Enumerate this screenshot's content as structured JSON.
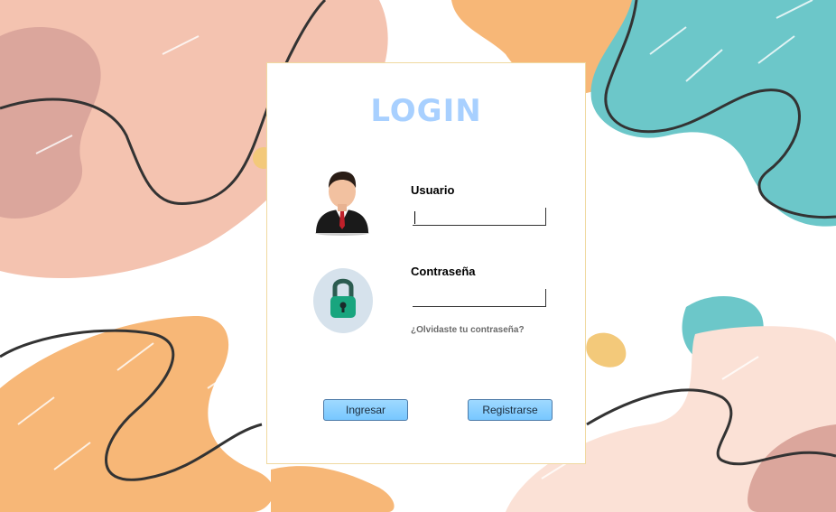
{
  "window": {
    "title": "LOGIN"
  },
  "colors": {
    "title": "#a8d0ff",
    "button": "#77c7ff",
    "panel_border": "#f0d9a0",
    "peach": "#f4c3b0",
    "orange": "#f7b777",
    "teal": "#6cc7c9",
    "rose": "#dba69c"
  },
  "form": {
    "user_label": "Usuario",
    "user_value": "",
    "password_label": "Contraseña",
    "password_value": "",
    "forgot_link": "¿Olvidaste tu contraseña?"
  },
  "buttons": {
    "login": "Ingresar",
    "register": "Registrarse"
  },
  "icons": {
    "user": "businessman-icon",
    "password": "padlock-icon"
  }
}
